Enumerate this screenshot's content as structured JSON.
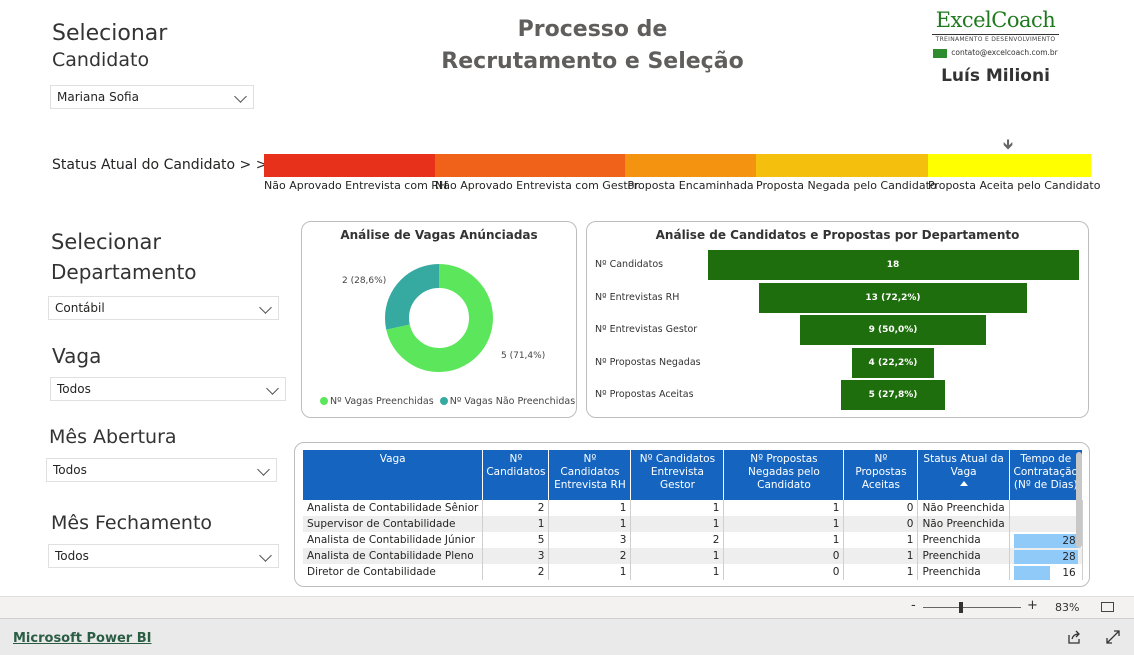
{
  "header": {
    "title_line1": "Processo de",
    "title_line2": "Recrutamento e Seleção"
  },
  "logo": {
    "brand_excel": "Excel",
    "brand_coach": "Coach",
    "tagline": "TREINAMENTO E DESENVOLVIMENTO",
    "email": "contato@excelcoach.com.br",
    "author": "Luís Milioni"
  },
  "slicers": {
    "candidato": {
      "title_line1": "Selecionar",
      "title_line2": "Candidato",
      "value": "Mariana Sofia"
    },
    "departamento": {
      "title_line1": "Selecionar",
      "title_line2": "Departamento",
      "value": "Contábil"
    },
    "vaga": {
      "title": "Vaga",
      "value": "Todos"
    },
    "mes_abertura": {
      "title": "Mês Abertura",
      "value": "Todos"
    },
    "mes_fechamento": {
      "title": "Mês Fechamento",
      "value": "Todos"
    }
  },
  "status": {
    "label": "Status Atual do Candidato > >",
    "stages": [
      {
        "label": "Não Aprovado Entrevista com RH",
        "color": "#e8311a"
      },
      {
        "label": "Não Aprovado Entrevista com Gestor",
        "color": "#f0621a"
      },
      {
        "label": "Proposta Encaminhada",
        "color": "#f39310"
      },
      {
        "label": "Proposta Negada pelo Candidato",
        "color": "#f5bf0e"
      },
      {
        "label": "Proposta Aceita pelo Candidato",
        "color": "#ffff00"
      }
    ],
    "current_stage_index": 4
  },
  "donut": {
    "title": "Análise de Vagas Anúnciadas",
    "slices": [
      {
        "name": "Nº Vagas Preenchidas",
        "value": 5,
        "label": "5 (71,4%)",
        "color": "#5ce65c"
      },
      {
        "name": "Nº Vagas Não Preenchidas",
        "value": 2,
        "label": "2 (28,6%)",
        "color": "#36a9a1"
      }
    ]
  },
  "chart_data": {
    "type": "bar",
    "title": "Análise de Candidatos e Propostas por Departamento",
    "categories": [
      "Nº Candidatos",
      "Nº Entrevistas RH",
      "Nº Entrevistas Gestor",
      "Nº Propostas Negadas",
      "Nº Propostas Aceitas"
    ],
    "values": [
      18,
      13,
      9,
      4,
      5
    ],
    "labels": [
      "18",
      "13 (72,2%)",
      "9 (50,0%)",
      "4 (22,2%)",
      "5 (27,8%)"
    ],
    "color": "#1f6e0d"
  },
  "table": {
    "headers": {
      "vaga": "Vaga",
      "candidatos": "Nº Candidatos",
      "entrev_rh": "Nº Candidatos Entrevista RH",
      "entrev_gestor": "Nº Candidatos Entrevista Gestor",
      "negadas": "Nº Propostas Negadas pelo Candidato",
      "aceitas": "Nº Propostas Aceitas",
      "status": "Status Atual da Vaga",
      "tempo": "Tempo de Contratação (Nº de Dias)"
    },
    "rows": [
      {
        "vaga": "Analista de Contabilidade Sênior",
        "candidatos": 2,
        "entrev_rh": 1,
        "entrev_gestor": 1,
        "negadas": 1,
        "aceitas": 0,
        "status": "Não Preenchida",
        "tempo": null
      },
      {
        "vaga": "Supervisor de Contabilidade",
        "candidatos": 1,
        "entrev_rh": 1,
        "entrev_gestor": 1,
        "negadas": 1,
        "aceitas": 0,
        "status": "Não Preenchida",
        "tempo": null
      },
      {
        "vaga": "Analista de Contabilidade Júnior",
        "candidatos": 5,
        "entrev_rh": 3,
        "entrev_gestor": 2,
        "negadas": 1,
        "aceitas": 1,
        "status": "Preenchida",
        "tempo": 28
      },
      {
        "vaga": "Analista de Contabilidade Pleno",
        "candidatos": 3,
        "entrev_rh": 2,
        "entrev_gestor": 1,
        "negadas": 0,
        "aceitas": 1,
        "status": "Preenchida",
        "tempo": 28
      },
      {
        "vaga": "Diretor de Contabilidade",
        "candidatos": 2,
        "entrev_rh": 1,
        "entrev_gestor": 1,
        "negadas": 0,
        "aceitas": 1,
        "status": "Preenchida",
        "tempo": 16
      }
    ]
  },
  "statusbar": {
    "zoom_minus": "-",
    "zoom_plus": "+",
    "zoom": "83%"
  },
  "footer": {
    "link": "Microsoft Power BI"
  }
}
